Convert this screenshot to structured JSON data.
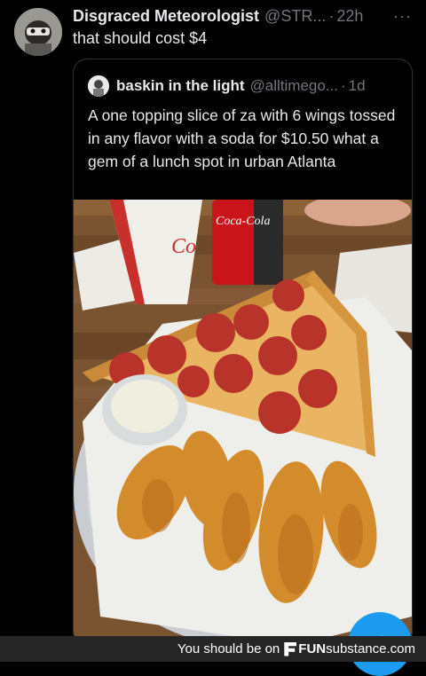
{
  "tweet": {
    "display_name": "Disgraced Meteorologist",
    "handle": "@STR...",
    "separator": "·",
    "time": "22h",
    "more_icon": "···",
    "text": "that should cost $4"
  },
  "quoted": {
    "display_name": "baskin in the light",
    "handle": "@alltimego...",
    "separator": "·",
    "time": "1d",
    "text": "A one topping slice of za with 6 wings tossed in any flavor with a soda for $10.50 what a gem of a lunch spot in urban Atlanta"
  },
  "photo": {
    "cup_label": "Co",
    "can_label": "Coca-Cola"
  },
  "compose_button": {
    "label": "+"
  },
  "footer": {
    "caption": "You should be on",
    "brand": "substance.com"
  },
  "colors": {
    "background": "#000000",
    "text_primary": "#e7e9ea",
    "text_secondary": "#71767b",
    "accent": "#1d9bf0",
    "footer_bg": "#262626"
  }
}
